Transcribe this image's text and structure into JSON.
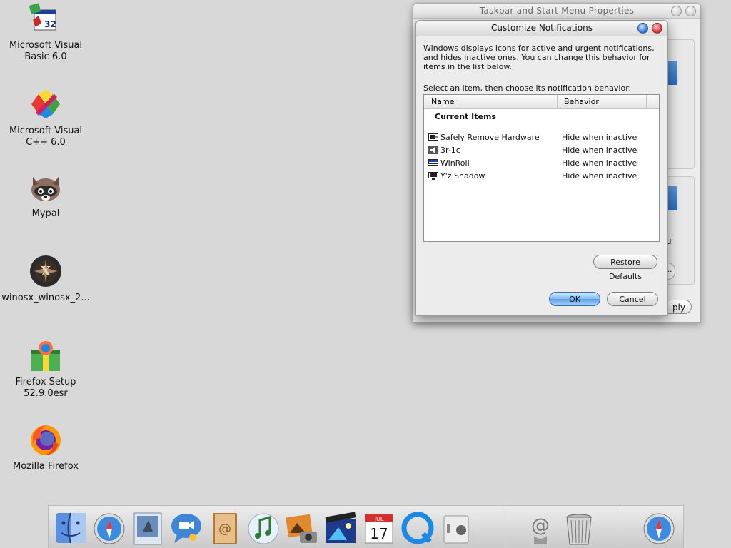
{
  "desktop": {
    "icons": [
      {
        "label": "Microsoft Visual\nBasic 6.0",
        "icon": "visual-basic-icon",
        "badge": "32"
      },
      {
        "label": "Microsoft Visual\nC++ 6.0",
        "icon": "visual-cpp-icon"
      },
      {
        "label": "Mypal",
        "icon": "mypal-raccoon-icon"
      },
      {
        "label": "winosx_winosx_2...",
        "icon": "winosx-icon",
        "glyph": "X"
      },
      {
        "label": "Firefox Setup\n52.9.0esr",
        "icon": "firefox-setup-icon"
      },
      {
        "label": "Mozilla Firefox",
        "icon": "firefox-icon"
      }
    ]
  },
  "back_window": {
    "title": "Taskbar and Start Menu Properties",
    "apply_label_partial": "ply",
    "side_text": "u",
    "dots_label": "..."
  },
  "dialog": {
    "title": "Customize Notifications",
    "description": "Windows displays icons for active and urgent notifications, and hides inactive ones. You can change this behavior for items in the list below.",
    "select_label": "Select an item, then choose its notification behavior:",
    "columns": {
      "name": "Name",
      "behavior": "Behavior"
    },
    "group_title": "Current Items",
    "items": [
      {
        "name": "Safely Remove Hardware",
        "behavior": "Hide when inactive",
        "icon": "hardware-icon"
      },
      {
        "name": "3r-1c",
        "behavior": "Hide when inactive",
        "icon": "speaker-icon"
      },
      {
        "name": "WinRoll",
        "behavior": "Hide when inactive",
        "icon": "winroll-icon"
      },
      {
        "name": "Y'z Shadow",
        "behavior": "Hide when inactive",
        "icon": "monitor-icon"
      }
    ],
    "restore_defaults_label": "Restore Defaults",
    "ok_label": "OK",
    "cancel_label": "Cancel"
  },
  "dock": {
    "items": [
      {
        "name": "finder-icon"
      },
      {
        "name": "safari-icon"
      },
      {
        "name": "mail-icon"
      },
      {
        "name": "ichat-icon"
      },
      {
        "name": "address-book-icon"
      },
      {
        "name": "itunes-icon"
      },
      {
        "name": "iphoto-icon"
      },
      {
        "name": "imovie-icon"
      },
      {
        "name": "ical-icon",
        "month": "JUL",
        "day": "17"
      },
      {
        "name": "quicktime-icon"
      },
      {
        "name": "system-preferences-icon"
      },
      {
        "name": "mail-at-icon"
      },
      {
        "name": "trash-icon"
      },
      {
        "name": "safari-download-icon"
      }
    ]
  },
  "colors": {
    "desktop": "#d8d8d8",
    "accent_blue": "#5aa0ea",
    "close_red": "#e03b3b"
  }
}
